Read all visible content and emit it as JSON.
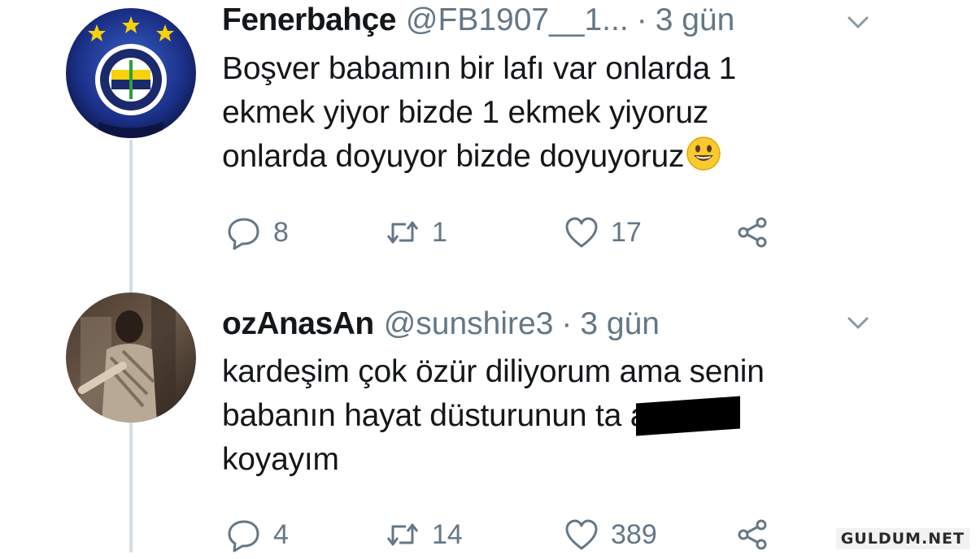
{
  "tweets": [
    {
      "display_name": "Fenerbahçe",
      "handle": "@FB1907__1...",
      "separator": "·",
      "time": "3 gün",
      "avatar_icon": "fenerbahce-crest-icon",
      "lines": [
        "Boşver babamın bir lafı var onlarda 1",
        "ekmek yiyor bizde 1 ekmek yiyoruz",
        "onlarda doyuyor bizde doyuyoruz"
      ],
      "emoji": "smiling-face-emoji",
      "replies": "8",
      "retweets": "1",
      "likes": "17"
    },
    {
      "display_name": "ozAnasAn",
      "handle": "@sunshire3",
      "separator": "·",
      "time": "3 gün",
      "avatar_icon": "user-photo-avatar",
      "lines": [
        "kardeşim çok özür diliyorum ama senin",
        "babanın hayat düsturunun ta a",
        "koyayım"
      ],
      "censored": true,
      "replies": "4",
      "retweets": "14",
      "likes": "389"
    }
  ],
  "watermark": "GULDUM.NET",
  "colors": {
    "text": "#14171a",
    "secondary": "#657786",
    "thread_line": "#d6dde3",
    "crest_blue": "#1b2a6b",
    "crest_yellow": "#f5d20a"
  }
}
